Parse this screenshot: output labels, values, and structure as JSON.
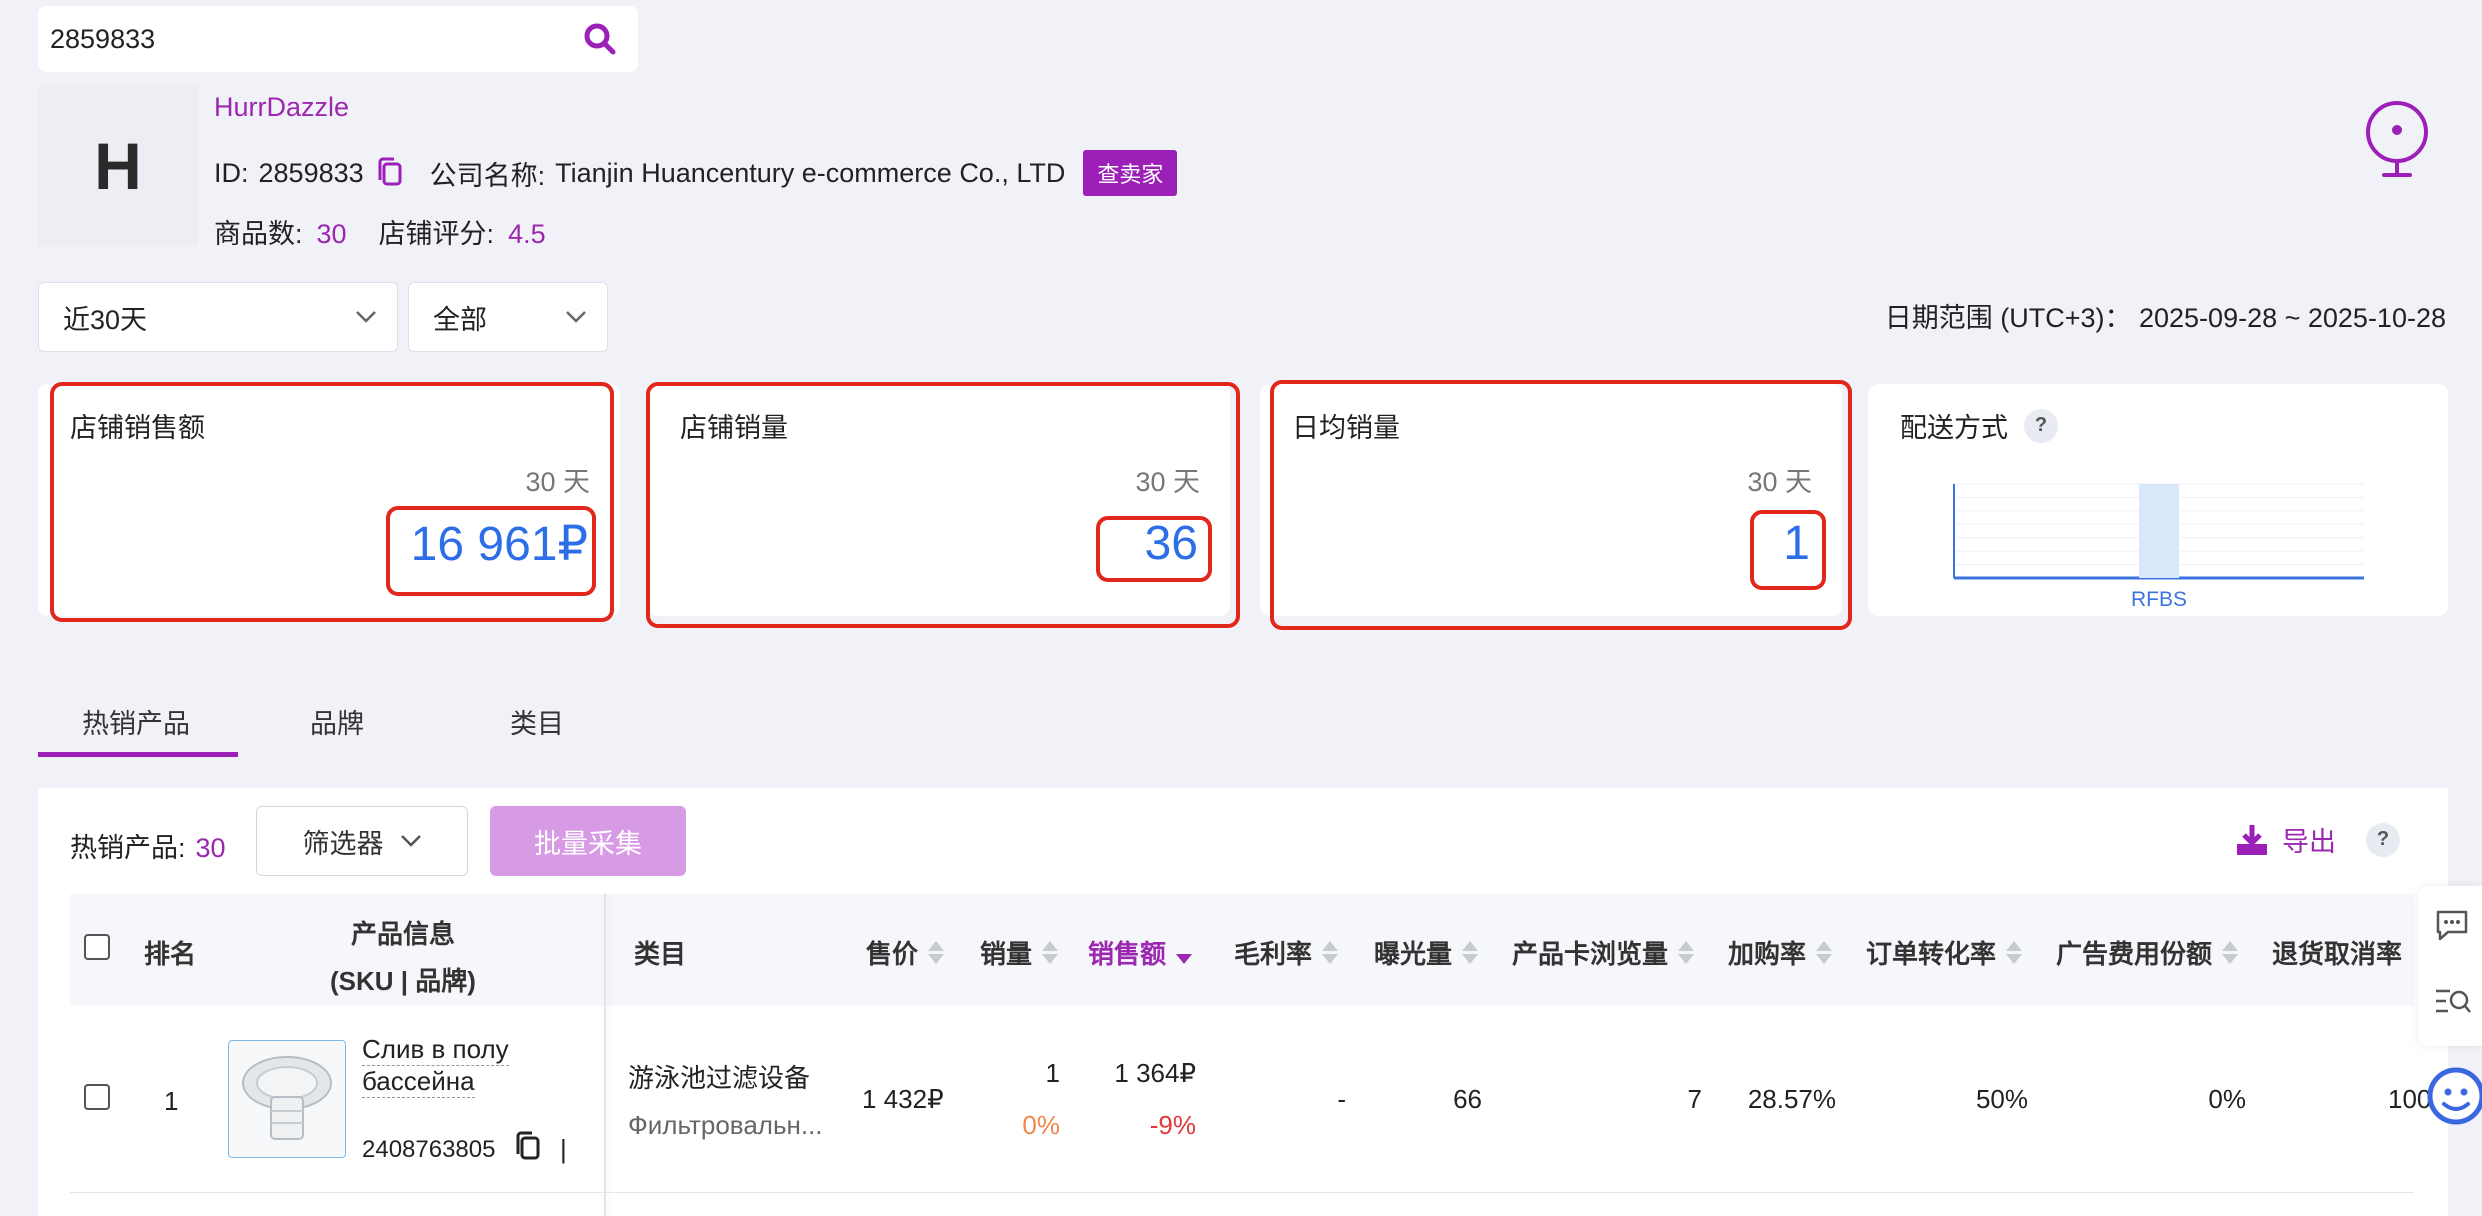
{
  "search": {
    "value": "2859833"
  },
  "seller": {
    "avatar_letter": "H",
    "name": "HurrDazzle",
    "id_label": "ID:",
    "id_value": "2859833",
    "company_label": "公司名称:",
    "company_value": "Tianjin Huancentury e-commerce Co., LTD",
    "check_seller_button": "查卖家",
    "product_count_label": "商品数:",
    "product_count_value": "30",
    "rating_label": "店铺评分:",
    "rating_value": "4.5"
  },
  "filters": {
    "period_select": "近30天",
    "scope_select": "全部",
    "date_range": "日期范围 (UTC+3)：  2025-09-28 ~ 2025-10-28"
  },
  "cards": [
    {
      "title": "店铺销售额",
      "period": "30 天",
      "value": "16 961₽"
    },
    {
      "title": "店铺销量",
      "period": "30 天",
      "value": "36"
    },
    {
      "title": "日均销量",
      "period": "30 天",
      "value": "1"
    }
  ],
  "delivery": {
    "title": "配送方式",
    "help": "?",
    "chart_data": {
      "type": "bar",
      "categories": [
        "RFBS"
      ],
      "values": [
        1
      ],
      "title": "",
      "xlabel": "",
      "ylabel": ""
    }
  },
  "tabs": [
    "热销产品",
    "品牌",
    "类目"
  ],
  "toolbar": {
    "hot_label": "热销产品:",
    "hot_count": "30",
    "filter_button": "筛选器",
    "batch_button": "批量采集",
    "export_label": "导出",
    "help": "?"
  },
  "table": {
    "headers": {
      "rank": "排名",
      "product_info": "产品信息",
      "product_info_sub": "(SKU | 品牌)",
      "category": "类目",
      "price": "售价",
      "sales": "销量",
      "revenue": "销售额",
      "margin": "毛利率",
      "impressions": "曝光量",
      "card_views": "产品卡浏览量",
      "cart_rate": "加购率",
      "conversion": "订单转化率",
      "ad_share": "广告费用份额",
      "return_rate": "退货取消率"
    },
    "rows": [
      {
        "rank": "1",
        "name_line1": "Слив в полу",
        "name_line2": "бассейна",
        "sku": "2408763805",
        "sku_sep": "|",
        "category_cn": "游泳池过滤设备",
        "category_ru": "Фильтровальн...",
        "price": "1 432₽",
        "sales": "1",
        "sales_change": "0%",
        "revenue": "1 364₽",
        "revenue_change": "-9%",
        "margin": "-",
        "impressions": "66",
        "card_views": "7",
        "cart_rate": "28.57%",
        "conversion": "50%",
        "ad_share": "0%",
        "return_rate": "100"
      }
    ]
  }
}
